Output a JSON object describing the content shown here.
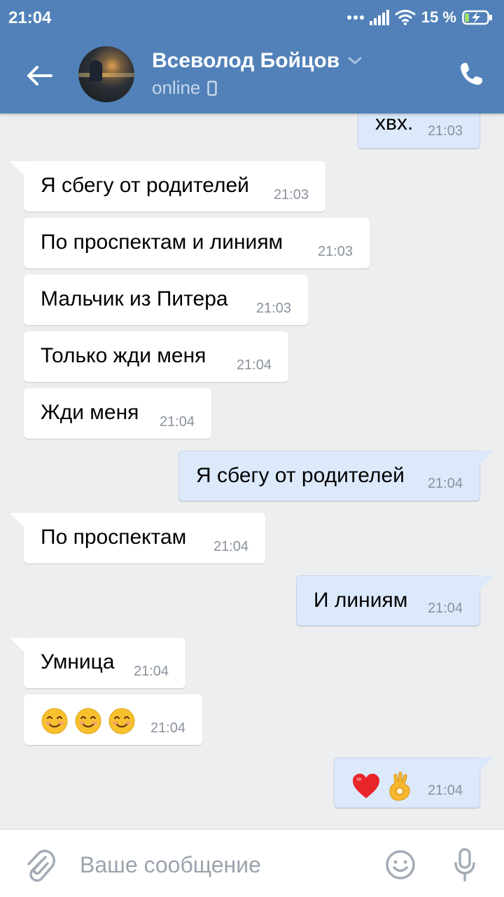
{
  "status_bar": {
    "time": "21:04",
    "battery": "15 %"
  },
  "header": {
    "contact_name": "Всеволод Бойцов",
    "contact_status": "online"
  },
  "messages": [
    {
      "direction": "out",
      "text": "хвх.",
      "time": "21:03"
    },
    {
      "direction": "in",
      "text": "Я сбегу от родителей",
      "time": "21:03"
    },
    {
      "direction": "in",
      "text": "По проспектам и линиям",
      "time": "21:03"
    },
    {
      "direction": "in",
      "text": "Мальчик из Питера",
      "time": "21:03"
    },
    {
      "direction": "in",
      "text": "Только жди меня",
      "time": "21:04"
    },
    {
      "direction": "in",
      "text": "Жди меня",
      "time": "21:04"
    },
    {
      "direction": "out",
      "text": "Я сбегу от родителей",
      "time": "21:04"
    },
    {
      "direction": "in",
      "text": "По проспектам",
      "time": "21:04"
    },
    {
      "direction": "out",
      "text": "И линиям",
      "time": "21:04"
    },
    {
      "direction": "in",
      "text": "Умница",
      "time": "21:04"
    },
    {
      "direction": "in",
      "emojis": [
        "smiling-face",
        "smiling-face",
        "smiling-face"
      ],
      "time": "21:04"
    },
    {
      "direction": "out",
      "emojis": [
        "red-heart",
        "ok-hand"
      ],
      "time": "21:04"
    }
  ],
  "composer": {
    "placeholder": "Ваше сообщение"
  },
  "colors": {
    "header_bg": "#5181b8",
    "chat_bg": "#edeef0",
    "incoming_bubble": "#ffffff",
    "outgoing_bubble": "#dce9fb"
  }
}
